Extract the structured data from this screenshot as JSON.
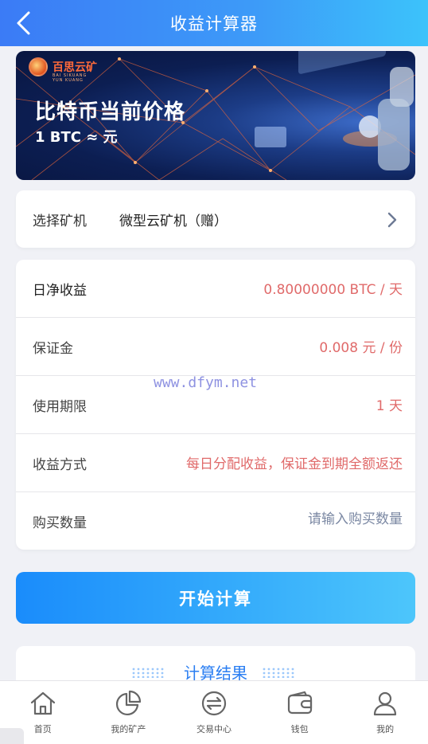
{
  "header": {
    "title": "收益计算器",
    "back_icon": "chevron-left-icon"
  },
  "banner": {
    "logo_text": "百思云矿",
    "logo_sub": "BAI SIKUANG YUN KUANG",
    "headline": "比特币当前价格",
    "price_line": "1 BTC ≈ 元"
  },
  "miner_select": {
    "label": "选择矿机",
    "value": "微型云矿机（赠）"
  },
  "info": {
    "daily_label": "日净收益",
    "daily_value": "0.80000000 BTC / 天",
    "deposit_label": "保证金",
    "deposit_value": "0.008 元 / 份",
    "term_label": "使用期限",
    "term_value": "1 天",
    "method_label": "收益方式",
    "method_value": "每日分配收益，保证金到期全额返还",
    "qty_label": "购买数量",
    "qty_value": "",
    "qty_placeholder": "请输入购买数量"
  },
  "watermark": "www.dfym.net",
  "calc_button": "开始计算",
  "result": {
    "title": "计算结果"
  },
  "tabbar": {
    "items": [
      {
        "label": "首页",
        "icon": "home-icon"
      },
      {
        "label": "我的矿产",
        "icon": "pie-chart-icon"
      },
      {
        "label": "交易中心",
        "icon": "exchange-icon"
      },
      {
        "label": "钱包",
        "icon": "wallet-icon"
      },
      {
        "label": "我的",
        "icon": "user-icon"
      }
    ]
  },
  "colors": {
    "accent": "#3b8df8",
    "value_red": "#e06a6a",
    "result_blue": "#2a7ef2"
  }
}
